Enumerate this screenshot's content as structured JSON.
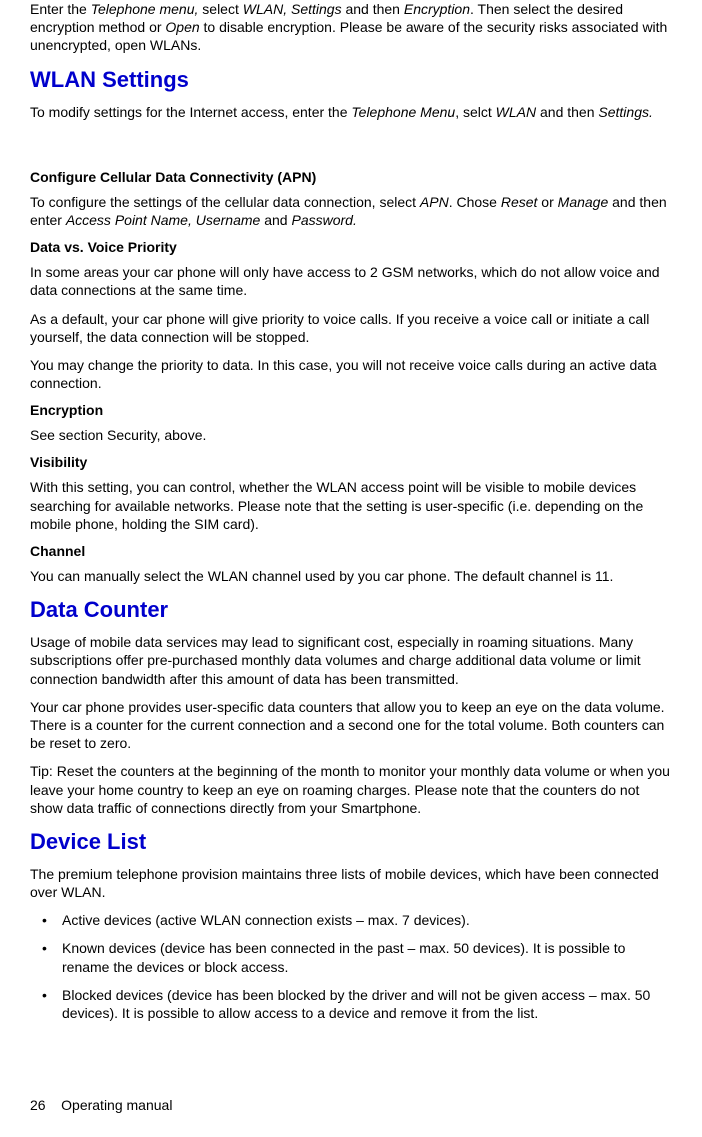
{
  "intro": {
    "p1_a": "Enter the ",
    "p1_b": "Telephone menu,",
    "p1_c": " select ",
    "p1_d": "WLAN, Settings",
    "p1_e": " and then ",
    "p1_f": "Encryption",
    "p1_g": ". Then select the desired encryption method or ",
    "p1_h": "Open",
    "p1_i": " to disable encryption. Please be aware of the security risks associated with unencrypted, open WLANs."
  },
  "wlan_settings": {
    "heading": "WLAN Settings",
    "p1_a": "To modify settings for the Internet access, enter the ",
    "p1_b": "Telephone Menu",
    "p1_c": ", selct ",
    "p1_d": "WLAN",
    "p1_e": " and then ",
    "p1_f": "Settings."
  },
  "apn": {
    "heading": "Configure Cellular Data Connectivity (APN)",
    "p1_a": "To configure the settings of the cellular data connection, select ",
    "p1_b": "APN",
    "p1_c": ". Chose ",
    "p1_d": "Reset",
    "p1_e": " or ",
    "p1_f": "Manage",
    "p1_g": " and then enter ",
    "p1_h": "Access Point Name, Username",
    "p1_i": " and ",
    "p1_j": "Password."
  },
  "priority": {
    "heading": "Data vs. Voice Priority",
    "p1": "In some areas your car phone will only have access to 2 GSM networks, which do not allow voice and data connections at the same time.",
    "p2": "As a default, your car phone will give priority to voice calls. If you receive a voice call or initiate a call yourself, the data connection will be stopped.",
    "p3": "You may change the priority to data. In this case, you will not receive voice calls during an active data connection."
  },
  "encryption": {
    "heading": "Encryption",
    "p1": "See section Security, above."
  },
  "visibility": {
    "heading": "Visibility",
    "p1": "With this setting, you can control, whether the WLAN access point will be visible to mobile devices searching for available networks. Please note that the setting is user-specific (i.e. depending on the mobile phone, holding the SIM card)."
  },
  "channel": {
    "heading": "Channel",
    "p1": "You can manually select the WLAN channel used by you car phone. The default channel is 11."
  },
  "data_counter": {
    "heading": "Data Counter",
    "p1": "Usage of mobile data services may lead to significant cost, especially in roaming situations. Many subscriptions offer pre-purchased monthly data volumes and charge additional data volume or limit connection bandwidth after this amount of data has been transmitted.",
    "p2": "Your car phone provides user-specific data counters that allow you to keep an eye on the data volume. There is a counter for the current connection and a second one for the total volume. Both counters can be reset to zero.",
    "p3": "Tip: Reset the counters at the beginning of the month to monitor your monthly data volume or when you leave your home country to keep an eye on roaming charges. Please note that the counters do not show data traffic of connections directly from your Smartphone."
  },
  "device_list": {
    "heading": "Device List",
    "p1": "The premium telephone provision maintains three lists of mobile devices, which have been connected over WLAN.",
    "bullets": [
      "Active devices (active WLAN connection exists – max. 7 devices).",
      "Known devices (device has been connected in the past – max. 50 devices). It is possible to rename the devices or block access.",
      "Blocked devices (device has been blocked by the driver and will not be given access – max. 50 devices). It is possible to allow access to a device and remove it from the list."
    ]
  },
  "footer": {
    "page_no": "26",
    "label": "Operating manual"
  }
}
